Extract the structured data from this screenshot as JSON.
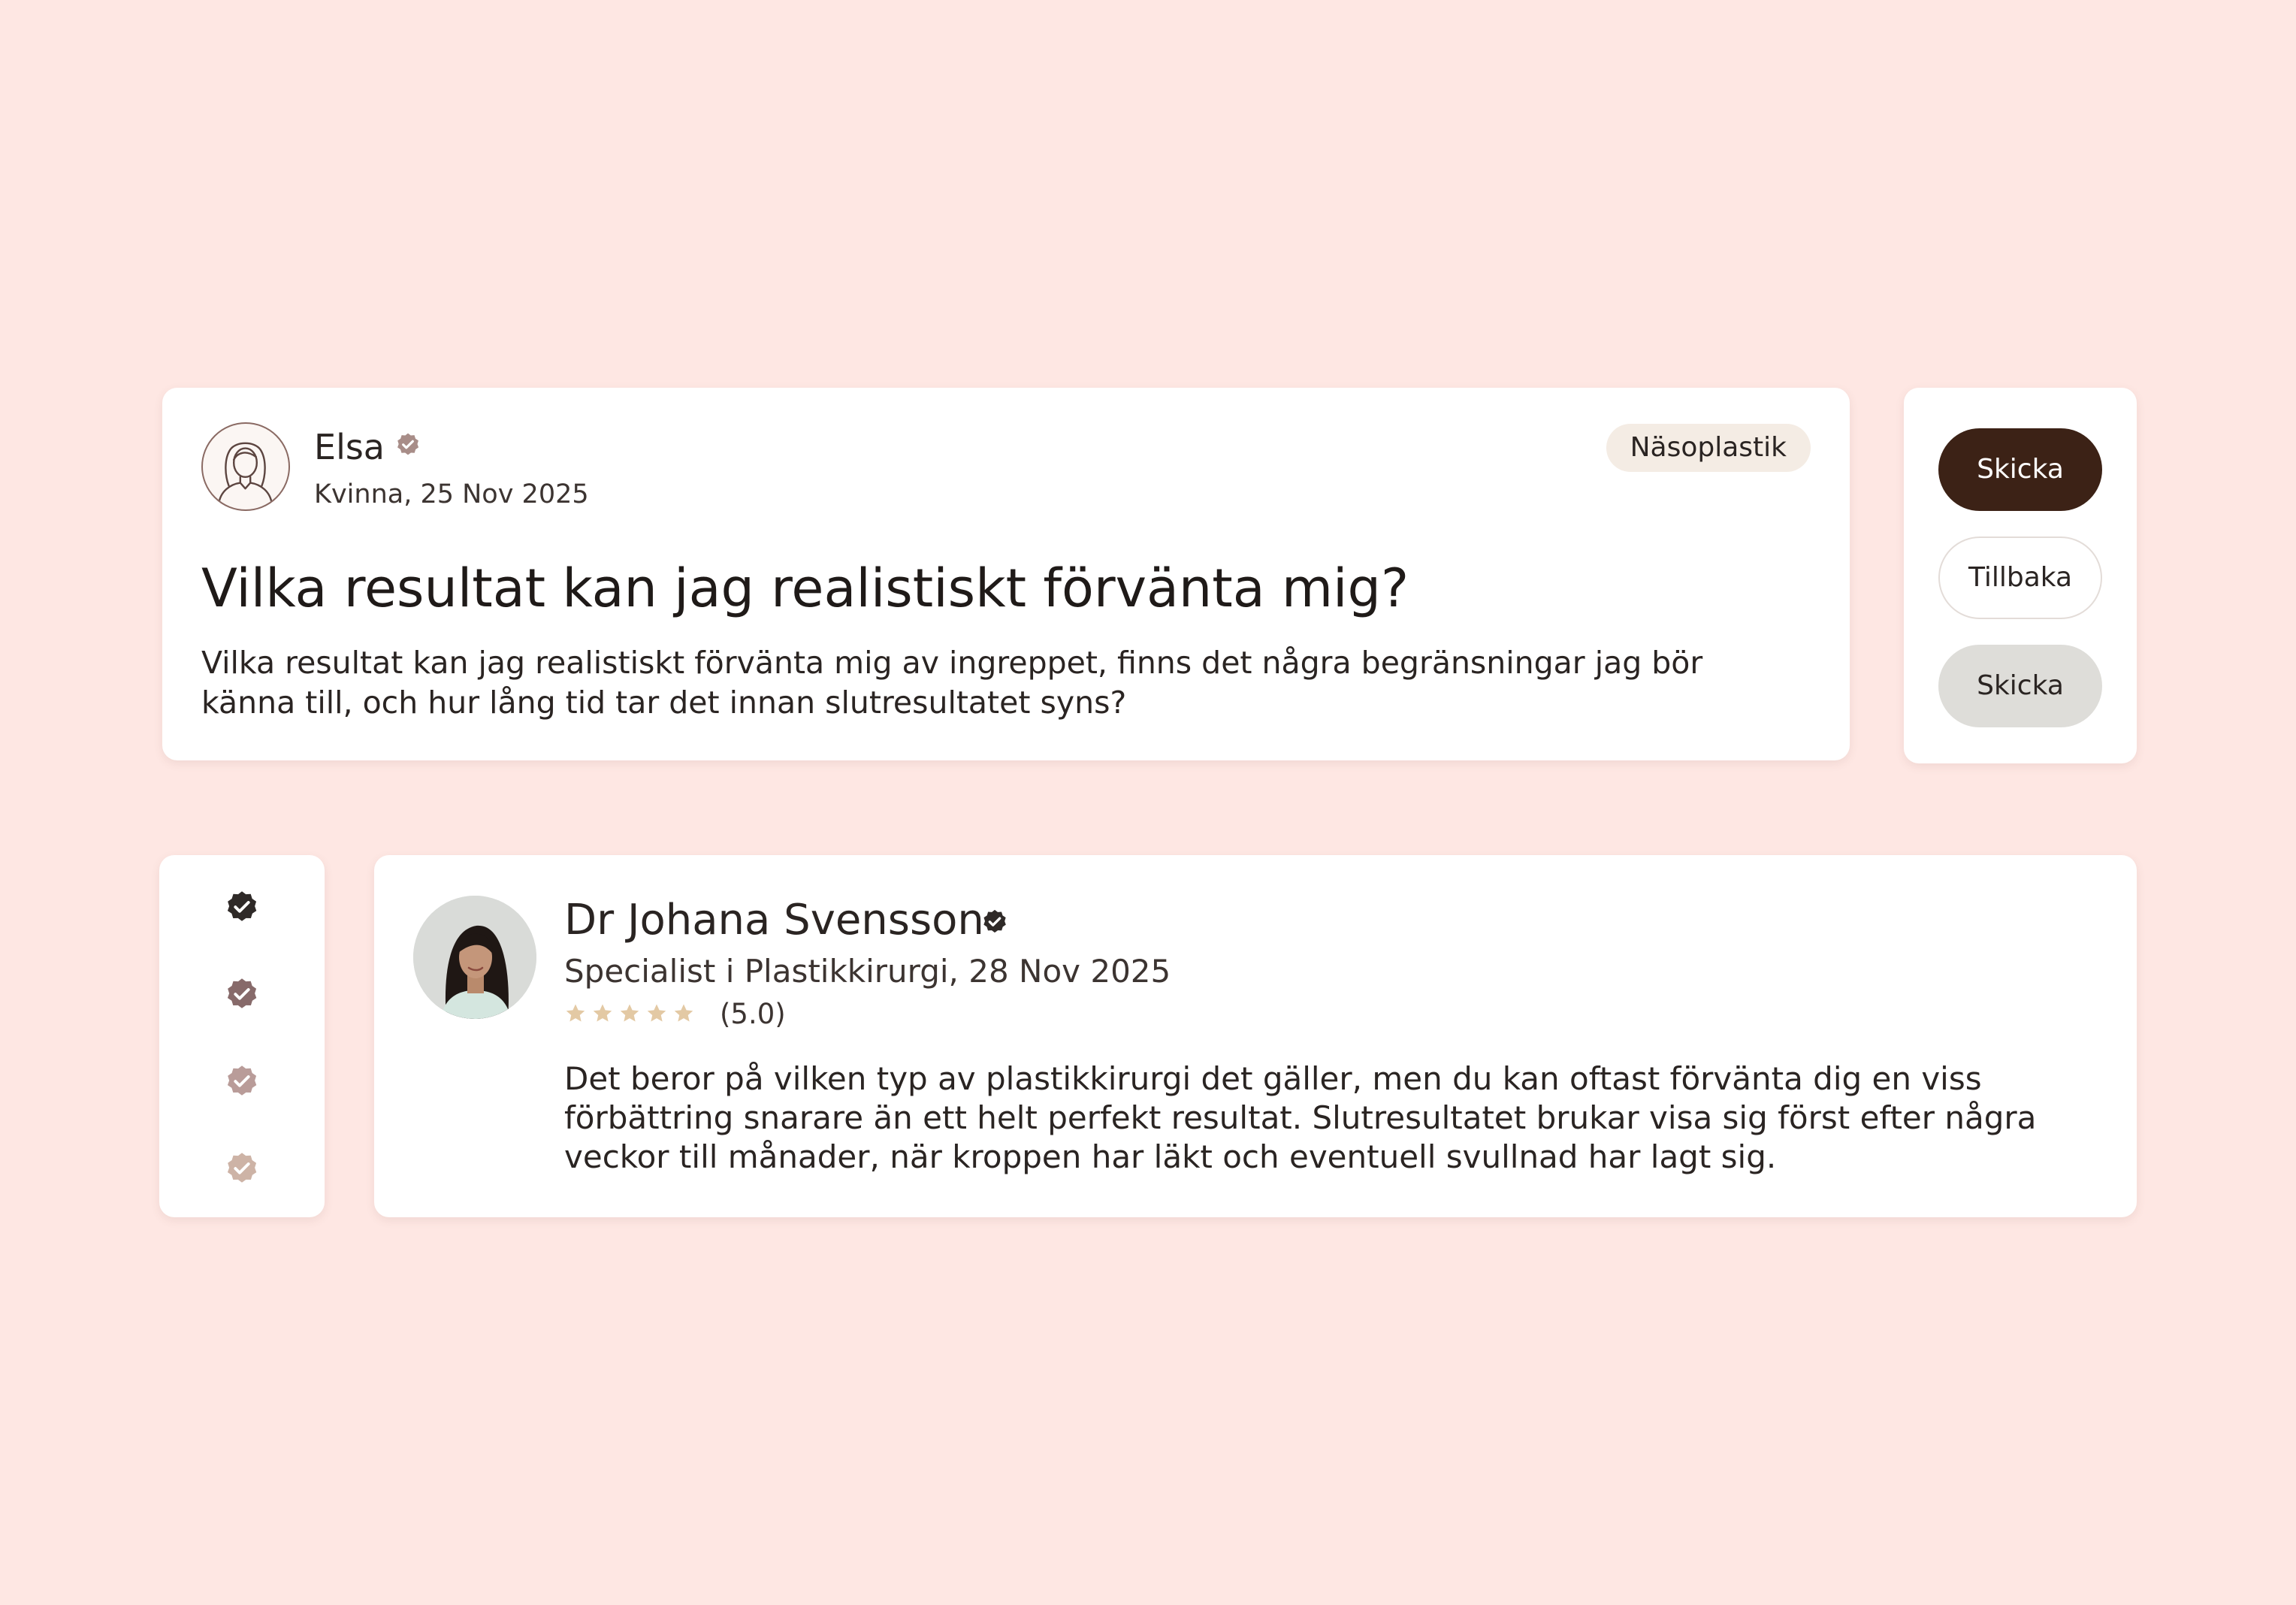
{
  "question": {
    "author_name": "Elsa",
    "author_meta": "Kvinna, 25 Nov 2025",
    "tag": "Näsoplastik",
    "title": "Vilka resultat kan jag realistiskt förvänta mig?",
    "body": "Vilka resultat kan jag realistiskt förvänta mig av ingreppet, finns det några begränsningar jag bör känna till, och hur lång tid tar det innan slutresultatet syns?",
    "avatar_icon": "woman-outline-avatar-icon",
    "verify_icon": "verified-badge-icon"
  },
  "buttons": {
    "primary_label": "Skicka",
    "secondary_label": "Tillbaka",
    "disabled_label": "Skicka"
  },
  "badges": [
    {
      "icon": "verified-badge-icon",
      "color": "#2f2a28"
    },
    {
      "icon": "verified-badge-icon",
      "color": "#876a6a"
    },
    {
      "icon": "verified-badge-icon",
      "color": "#b99c99"
    },
    {
      "icon": "verified-badge-icon",
      "color": "#cdb3a6"
    }
  ],
  "answer": {
    "doctor_name": "Dr Johana Svensson",
    "doctor_meta": "Specialist i Plastikkirurgi, 28 Nov 2025",
    "rating_text": "(5.0)",
    "rating_value": 5,
    "rating_max": 5,
    "body": "Det beror på vilken typ av plastikkirurgi det gäller, men du kan oftast förvänta dig en viss förbättring snarare än ett helt perfekt resultat. Slutresultatet brukar visa sig först efter några veckor till månader, när kroppen har läkt och eventuell svullnad har lagt sig."
  },
  "colors": {
    "background": "#fee7e3",
    "primary_button": "#3c2216",
    "disabled_button": "#deddd9",
    "tag_background": "#f4ece4",
    "star": "#e3c9a4",
    "verify_muted": "#a88d88",
    "verify_dark": "#2f2a28"
  }
}
